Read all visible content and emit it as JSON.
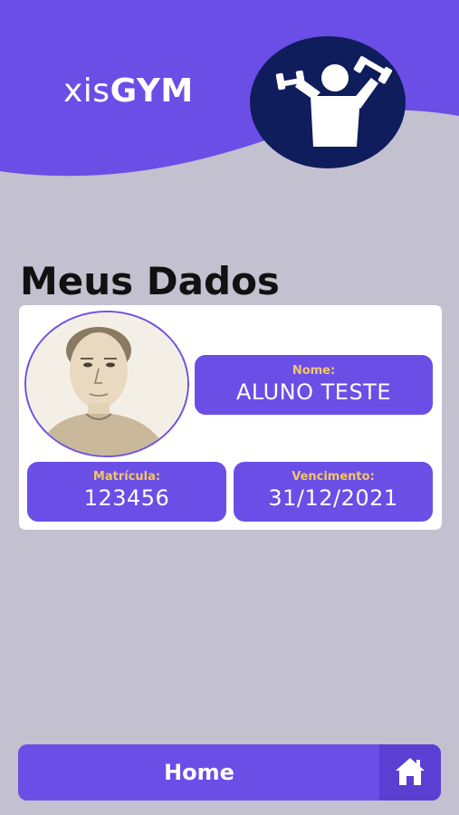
{
  "header": {
    "brand_light": "xis",
    "brand_bold": "GYM",
    "logo_icon": "dumbbell-person-icon",
    "color": "#6b4ee6",
    "logo_bg": "#0f1d5c"
  },
  "page": {
    "title": "Meus Dados",
    "background": "#c3c0cf"
  },
  "profile": {
    "avatar_icon": "user-photo",
    "nome_label": "Nome:",
    "nome_value": "ALUNO TESTE",
    "matricula_label": "Matrícula:",
    "matricula_value": "123456",
    "vencimento_label": "Vencimento:",
    "vencimento_value": "31/12/2021",
    "label_color": "#f2c764"
  },
  "bottom_nav": {
    "home_label": "Home",
    "home_icon": "home-icon"
  }
}
